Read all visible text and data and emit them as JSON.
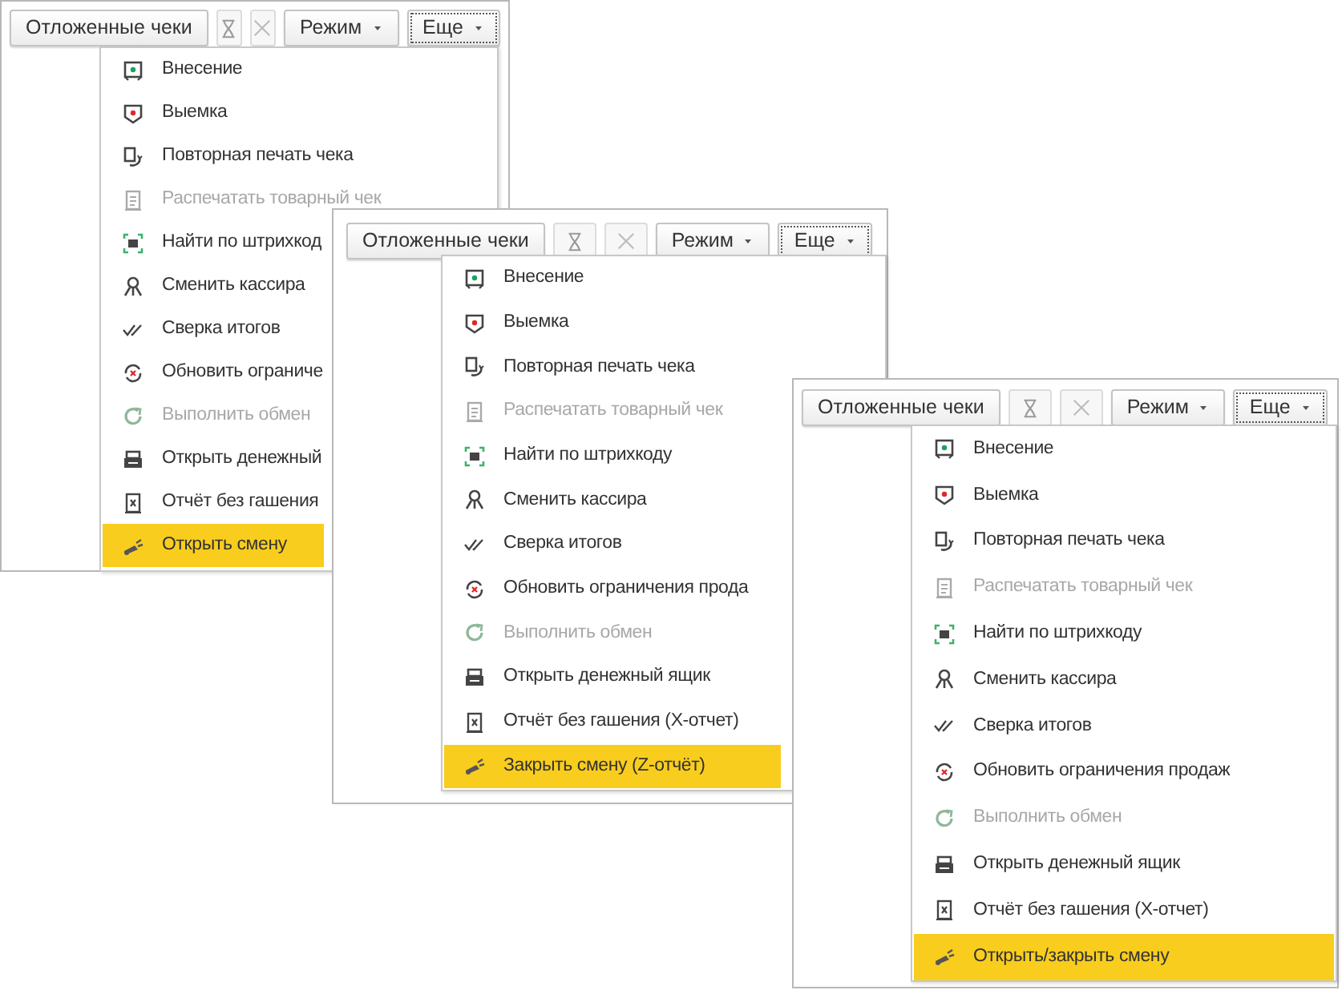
{
  "panels": [
    {
      "toolbar": [
        {
          "kind": "text",
          "label": "Отложенные чеки",
          "disabled": false,
          "focused": false
        },
        {
          "kind": "icon",
          "disabled": true,
          "focused": false
        },
        {
          "kind": "icon",
          "disabled": true,
          "focused": false
        },
        {
          "kind": "dropdown",
          "label": "Режим",
          "disabled": false,
          "focused": false
        },
        {
          "kind": "dropdown",
          "label": "Еще",
          "disabled": false,
          "focused": true
        }
      ],
      "menu": [
        {
          "label": "Внесение",
          "disabled": false,
          "selected": false
        },
        {
          "label": "Выемка",
          "disabled": false,
          "selected": false
        },
        {
          "label": "Повторная печать чека",
          "disabled": false,
          "selected": false
        },
        {
          "label": "Распечатать товарный чек",
          "disabled": true,
          "selected": false
        },
        {
          "label": "Найти по штрихкод",
          "disabled": false,
          "selected": false
        },
        {
          "label": "Сменить кассира",
          "disabled": false,
          "selected": false
        },
        {
          "label": "Сверка итогов",
          "disabled": false,
          "selected": false
        },
        {
          "label": "Обновить ограниче",
          "disabled": false,
          "selected": false
        },
        {
          "label": "Выполнить обмен",
          "disabled": true,
          "selected": false
        },
        {
          "label": "Открыть денежный",
          "disabled": false,
          "selected": false
        },
        {
          "label": "Отчёт без гашения",
          "disabled": false,
          "selected": false
        },
        {
          "label": "Открыть смену",
          "disabled": false,
          "selected": true
        }
      ]
    },
    {
      "toolbar": [
        {
          "kind": "text",
          "label": "Отложенные чеки",
          "disabled": false,
          "focused": false
        },
        {
          "kind": "icon",
          "disabled": true,
          "focused": false
        },
        {
          "kind": "icon",
          "disabled": true,
          "focused": false
        },
        {
          "kind": "dropdown",
          "label": "Режим",
          "disabled": false,
          "focused": false
        },
        {
          "kind": "dropdown",
          "label": "Еще",
          "disabled": false,
          "focused": true
        }
      ],
      "menu": [
        {
          "label": "Внесение",
          "disabled": false,
          "selected": false
        },
        {
          "label": "Выемка",
          "disabled": false,
          "selected": false
        },
        {
          "label": "Повторная печать чека",
          "disabled": false,
          "selected": false
        },
        {
          "label": "Распечатать товарный чек",
          "disabled": true,
          "selected": false
        },
        {
          "label": "Найти по штрихкоду",
          "disabled": false,
          "selected": false
        },
        {
          "label": "Сменить кассира",
          "disabled": false,
          "selected": false
        },
        {
          "label": "Сверка итогов",
          "disabled": false,
          "selected": false
        },
        {
          "label": "Обновить ограничения прода",
          "disabled": false,
          "selected": false
        },
        {
          "label": "Выполнить обмен",
          "disabled": true,
          "selected": false
        },
        {
          "label": "Открыть денежный ящик",
          "disabled": false,
          "selected": false
        },
        {
          "label": "Отчёт без гашения (X-отчет)",
          "disabled": false,
          "selected": false
        },
        {
          "label": "Закрыть смену (Z-отчёт)",
          "disabled": false,
          "selected": true
        }
      ]
    },
    {
      "toolbar": [
        {
          "kind": "text",
          "label": "Отложенные чеки",
          "disabled": false,
          "focused": false
        },
        {
          "kind": "icon",
          "disabled": true,
          "focused": false
        },
        {
          "kind": "icon",
          "disabled": true,
          "focused": false
        },
        {
          "kind": "dropdown",
          "label": "Режим",
          "disabled": false,
          "focused": false
        },
        {
          "kind": "dropdown",
          "label": "Еще",
          "disabled": false,
          "focused": true
        }
      ],
      "menu": [
        {
          "label": "Внесение",
          "disabled": false,
          "selected": false
        },
        {
          "label": "Выемка",
          "disabled": false,
          "selected": false
        },
        {
          "label": "Повторная печать чека",
          "disabled": false,
          "selected": false
        },
        {
          "label": "Распечатать товарный чек",
          "disabled": true,
          "selected": false
        },
        {
          "label": "Найти по штрихкоду",
          "disabled": false,
          "selected": false
        },
        {
          "label": "Сменить кассира",
          "disabled": false,
          "selected": false
        },
        {
          "label": "Сверка итогов",
          "disabled": false,
          "selected": false
        },
        {
          "label": "Обновить ограничения продаж",
          "disabled": false,
          "selected": false
        },
        {
          "label": "Выполнить обмен",
          "disabled": true,
          "selected": false
        },
        {
          "label": "Открыть денежный ящик",
          "disabled": false,
          "selected": false
        },
        {
          "label": "Отчёт без гашения (X-отчет)",
          "disabled": false,
          "selected": false
        },
        {
          "label": "Открыть/закрыть смену",
          "disabled": false,
          "selected": true
        }
      ]
    }
  ]
}
